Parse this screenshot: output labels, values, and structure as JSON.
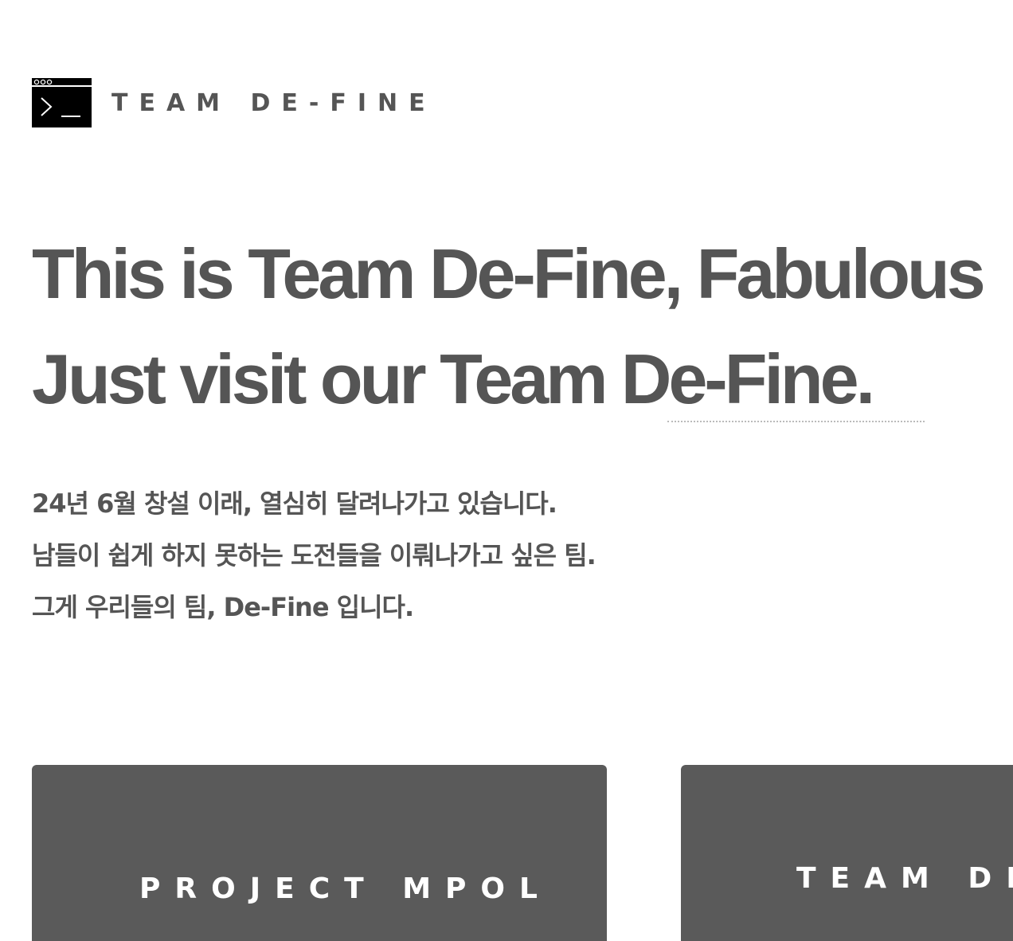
{
  "header": {
    "logo_icon": "terminal-icon",
    "brand": "TEAM DE-FINE"
  },
  "hero": {
    "line1": "This is Team De-Fine, Fabulous",
    "line2": "Just visit our Team De-Fine."
  },
  "intro": {
    "line1": "24년 6월 창설 이래, 열심히 달려나가고 있습니다.",
    "line2": "남들이 쉽게 하지 못하는 도전들을 이뤄나가고 싶은 팀.",
    "line3": "그게 우리들의 팀, De-Fine 입니다."
  },
  "cards": [
    {
      "title": "PROJECT MPOL"
    },
    {
      "title": "TEAM DE-FINE"
    }
  ],
  "colors": {
    "text": "#555555",
    "card_bg": "#5a5a5a",
    "card_text": "#ffffff"
  }
}
